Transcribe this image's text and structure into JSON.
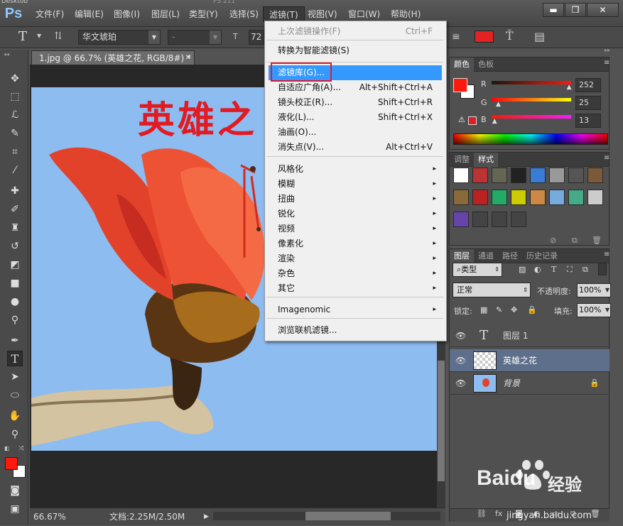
{
  "window": {
    "title_fragment": "Desktop",
    "doc_title_fragment": "PS 211"
  },
  "app": {
    "logo": "Ps"
  },
  "menubar": {
    "items": [
      "文件(F)",
      "编辑(E)",
      "图像(I)",
      "图层(L)",
      "类型(Y)",
      "选择(S)",
      "滤镜(T)",
      "视图(V)",
      "窗口(W)",
      "帮助(H)"
    ],
    "active": "滤镜(T)"
  },
  "window_controls": {
    "minimize": "▬",
    "restore": "❐",
    "close": "✕"
  },
  "options": {
    "text_tool": "T",
    "font_family": "华文琥珀",
    "font_style": "-",
    "font_size": "72",
    "color": "#e52222"
  },
  "document": {
    "tab": "1.jpg @ 66.7% (英雄之花, RGB/8#) *",
    "canvas_text": "英雄之",
    "zoom": "66.67%",
    "doc_info": "文档:2.25M/2.50M"
  },
  "filter_menu": {
    "items": [
      {
        "label": "上次滤镜操作(F)",
        "shortcut": "Ctrl+F",
        "disabled": true
      },
      {
        "label": "转换为智能滤镜(S)"
      },
      {
        "label": "滤镜库(G)...",
        "highlighted": true
      },
      {
        "label": "自适应广角(A)...",
        "shortcut": "Alt+Shift+Ctrl+A"
      },
      {
        "label": "镜头校正(R)...",
        "shortcut": "Shift+Ctrl+R"
      },
      {
        "label": "液化(L)...",
        "shortcut": "Shift+Ctrl+X"
      },
      {
        "label": "油画(O)..."
      },
      {
        "label": "消失点(V)...",
        "shortcut": "Alt+Ctrl+V"
      },
      {
        "label": "风格化",
        "submenu": true
      },
      {
        "label": "模糊",
        "submenu": true
      },
      {
        "label": "扭曲",
        "submenu": true
      },
      {
        "label": "锐化",
        "submenu": true
      },
      {
        "label": "视频",
        "submenu": true
      },
      {
        "label": "像素化",
        "submenu": true
      },
      {
        "label": "渲染",
        "submenu": true
      },
      {
        "label": "杂色",
        "submenu": true
      },
      {
        "label": "其它",
        "submenu": true
      },
      {
        "label": "Imagenomic",
        "submenu": true
      },
      {
        "label": "浏览联机滤镜..."
      }
    ],
    "submenu_arrow": "▸"
  },
  "color_panel": {
    "tabs": [
      "颜色",
      "色板"
    ],
    "r_label": "R",
    "g_label": "G",
    "b_label": "B",
    "r": "252",
    "g": "25",
    "b": "13",
    "fg_color": "#fc190d",
    "bg_color": "#ffffff",
    "r_fraction": 0.988,
    "g_fraction": 0.098,
    "b_fraction": 0.051
  },
  "styles_panel": {
    "tabs": [
      "调整",
      "样式"
    ]
  },
  "layers_panel": {
    "tabs": [
      "图层",
      "通道",
      "路径",
      "历史记录"
    ],
    "filter_kind": "类型",
    "blend_mode": "正常",
    "opacity_label": "不透明度:",
    "opacity": "100%",
    "lock_label": "锁定:",
    "fill_label": "填充:",
    "fill": "100%",
    "layers": [
      {
        "name": "图层 1",
        "type": "text",
        "selected": false
      },
      {
        "name": "英雄之花",
        "type": "pixel",
        "selected": true
      },
      {
        "name": "背景",
        "type": "image",
        "selected": false,
        "locked": true
      }
    ]
  },
  "watermark": {
    "brand": "Baidu",
    "brand_cn": "经验",
    "url": "jingyan.baidu.com"
  }
}
